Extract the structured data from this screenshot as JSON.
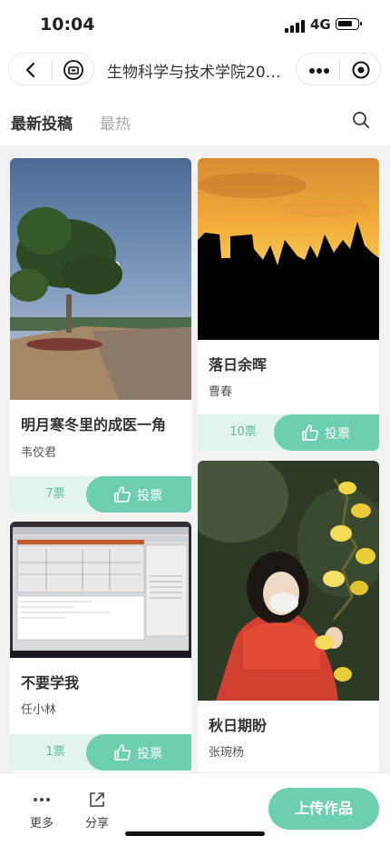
{
  "status": {
    "time": "10:04",
    "network": "4G"
  },
  "navbar": {
    "title": "生物科学与技术学院20…"
  },
  "tabs": {
    "active": "最新投稿",
    "inactive": "最热"
  },
  "posts": [
    {
      "title": "明月寒冬里的成医一角",
      "author": "韦佼君",
      "votes": "7票",
      "vote_label": "投票"
    },
    {
      "title": "落日余晖",
      "author": "曹春",
      "votes": "10票",
      "vote_label": "投票"
    },
    {
      "title": "不要学我",
      "author": "任小林",
      "votes": "1票",
      "vote_label": "投票"
    },
    {
      "title": "秋日期盼",
      "author": "张琬杨"
    }
  ],
  "bottom": {
    "more_label": "更多",
    "share_label": "分享",
    "upload_label": "上传作品"
  },
  "colors": {
    "accent": "#6dcfaf",
    "accent_light": "#e3f3ee"
  }
}
